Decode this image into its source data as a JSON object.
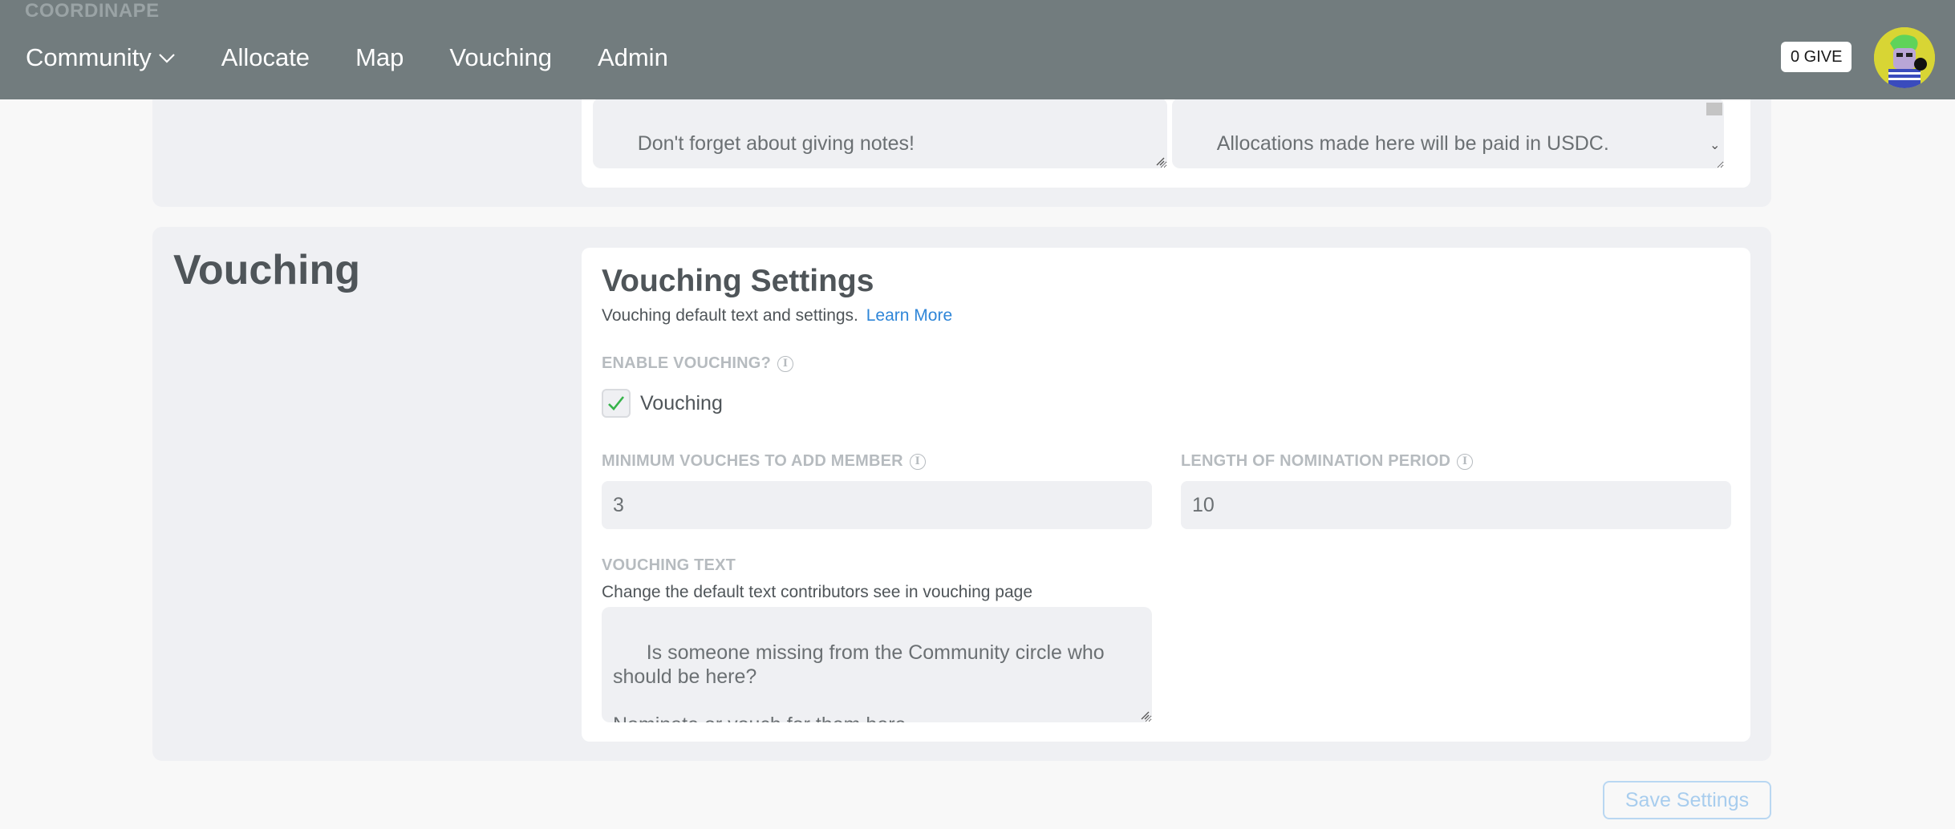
{
  "app": {
    "brand": "COORDINAPE"
  },
  "nav": {
    "items": [
      {
        "label": "Community"
      },
      {
        "label": "Allocate"
      },
      {
        "label": "Map"
      },
      {
        "label": "Vouching"
      },
      {
        "label": "Admin"
      }
    ],
    "give_badge": "0 GIVE"
  },
  "prev_section": {
    "notes_text": "Don't forget about giving notes!",
    "allocation_text": "Allocations made here will be paid in USDC.\n\nYou can leave notes without an allocation."
  },
  "vouching": {
    "section_title": "Vouching",
    "panel_title": "Vouching Settings",
    "panel_subtitle": "Vouching default text and settings.",
    "learn_more": "Learn More",
    "enable_label": "ENABLE VOUCHING?",
    "checkbox_label": "Vouching",
    "checkbox_checked": true,
    "min_vouches_label": "MINIMUM VOUCHES TO ADD MEMBER",
    "min_vouches_value": "3",
    "nomination_label": "LENGTH OF NOMINATION PERIOD",
    "nomination_value": "10",
    "text_label": "VOUCHING TEXT",
    "text_help": "Change the default text contributors see in vouching page",
    "text_value": "Is someone missing from the Community circle who should be here?\n\nNominate or vouch for them here."
  },
  "actions": {
    "save_label": "Save Settings"
  },
  "colors": {
    "topbar": "#727c7e",
    "section_bg": "#eff0f3",
    "link": "#2f86d8",
    "check": "#36b34a",
    "avatar_bg": "#d8d534"
  },
  "icons": [
    "chevron-down-icon",
    "info-icon",
    "checkmark-icon",
    "resize-grip-icon"
  ]
}
